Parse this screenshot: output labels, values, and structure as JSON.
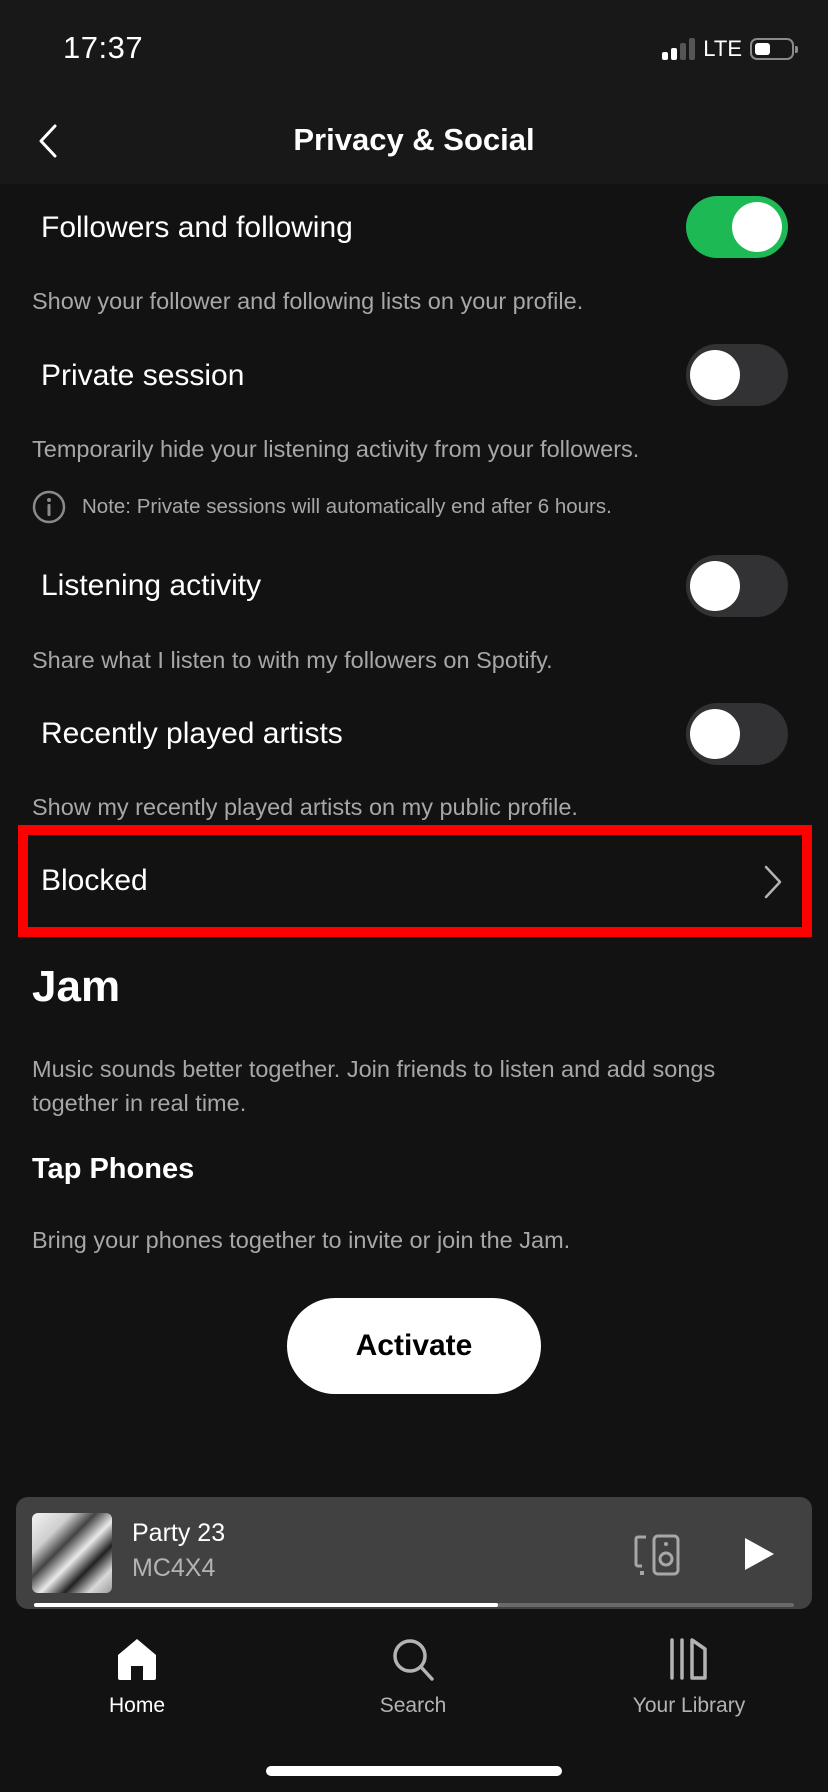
{
  "status_bar": {
    "time": "17:37",
    "network": "LTE",
    "signal_bars_active": 2,
    "signal_bars_total": 4,
    "battery_level": 0.45
  },
  "header": {
    "title": "Privacy & Social",
    "back_icon": "chevron-left-icon"
  },
  "settings": [
    {
      "label": "Followers and following",
      "description": "Show your follower and following lists on your profile.",
      "enabled": true
    },
    {
      "label": "Private session",
      "description": "Temporarily hide your listening activity from your followers.",
      "enabled": false
    },
    {
      "label": "Listening activity",
      "description": "Share what I listen to with my followers on Spotify.",
      "enabled": false
    },
    {
      "label": "Recently played artists",
      "description": "Show my recently played artists on my public profile.",
      "enabled": false
    }
  ],
  "note": {
    "icon": "info-icon",
    "text": "Note: Private sessions will automatically end after 6 hours."
  },
  "blocked": {
    "label": "Blocked",
    "icon": "chevron-right-icon",
    "highlight_color": "#ff0000"
  },
  "jam": {
    "title": "Jam",
    "description": "Music sounds better together. Join friends to listen and add songs together in real time.",
    "tap_title": "Tap Phones",
    "tap_description": "Bring your phones together to invite or join the Jam.",
    "activate_label": "Activate"
  },
  "now_playing": {
    "title": "Party 23",
    "artist": "MC4X4",
    "progress": 0.61,
    "device_icon": "connect-device-icon",
    "play_icon": "play-icon"
  },
  "nav": [
    {
      "label": "Home",
      "icon": "home-icon",
      "active": true
    },
    {
      "label": "Search",
      "icon": "search-icon",
      "active": false
    },
    {
      "label": "Your Library",
      "icon": "library-icon",
      "active": false
    }
  ],
  "colors": {
    "accent": "#1db954",
    "background": "#121212",
    "header_background": "#181818",
    "secondary_text": "#a7a7a7",
    "player_background": "#414141"
  }
}
